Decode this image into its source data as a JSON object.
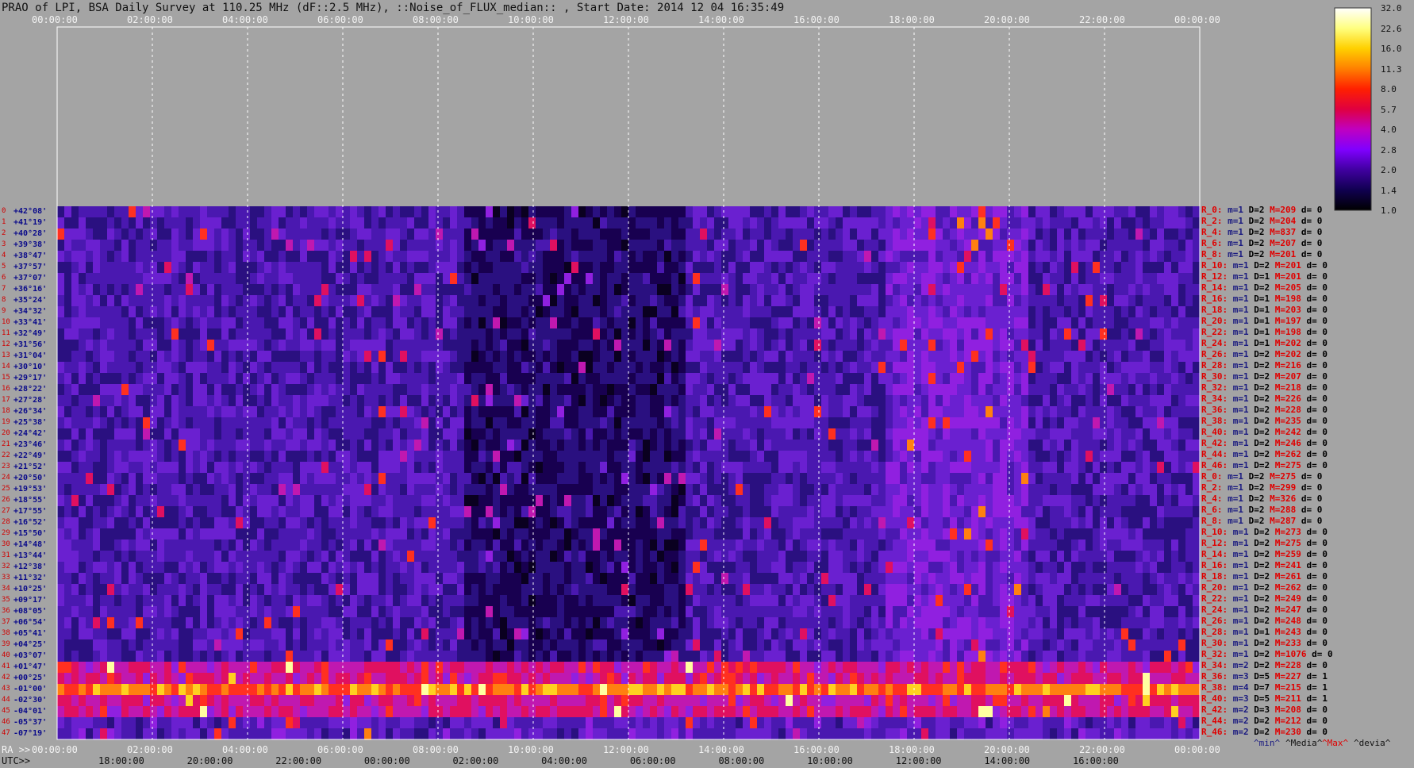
{
  "title": "PRAO of LPI, BSA Daily Survey at 110.25 MHz (dF::2.5 MHz), ::Noise_of_FLUX_median:: , Start Date: 2014 12 04 16:35:49",
  "chart_data": {
    "type": "heatmap",
    "x_top_ticks": [
      "00:00:00",
      "02:00:00",
      "04:00:00",
      "06:00:00",
      "08:00:00",
      "10:00:00",
      "12:00:00",
      "14:00:00",
      "16:00:00",
      "18:00:00",
      "20:00:00",
      "22:00:00",
      "00:00:00"
    ],
    "x_bottom_ra_label": "RA >>",
    "x_bottom_ticks": [
      "00:00:00",
      "02:00:00",
      "04:00:00",
      "06:00:00",
      "08:00:00",
      "10:00:00",
      "12:00:00",
      "14:00:00",
      "16:00:00",
      "18:00:00",
      "20:00:00",
      "22:00:00",
      "00:00:00"
    ],
    "x_utc_label": "UTC>>",
    "x_utc_ticks": [
      "18:00:00",
      "20:00:00",
      "22:00:00",
      "00:00:00",
      "02:00:00",
      "04:00:00",
      "06:00:00",
      "08:00:00",
      "10:00:00",
      "12:00:00",
      "14:00:00",
      "16:00:00"
    ],
    "dec_labels": [
      "+42°08'",
      "+41°19'",
      "+40°28'",
      "+39°38'",
      "+38°47'",
      "+37°57'",
      "+37°07'",
      "+36°16'",
      "+35°24'",
      "+34°32'",
      "+33°41'",
      "+32°49'",
      "+31°56'",
      "+31°04'",
      "+30°10'",
      "+29°17'",
      "+28°22'",
      "+27°28'",
      "+26°34'",
      "+25°38'",
      "+24°42'",
      "+23°46'",
      "+22°49'",
      "+21°52'",
      "+20°50'",
      "+19°53'",
      "+18°55'",
      "+17°55'",
      "+16°52'",
      "+15°50'",
      "+14°48'",
      "+13°44'",
      "+12°38'",
      "+11°32'",
      "+10°25'",
      "+09°17'",
      "+08°05'",
      "+06°54'",
      "+05°41'",
      "+04°25'",
      "+03°07'",
      "+01°47'",
      "+00°25'",
      "-01°00'",
      "-02°30'",
      "-04°01'",
      "-05°37'",
      "-07°19'"
    ],
    "colorbar_ticks": [
      "32.0",
      "22.6",
      "16.0",
      "11.3",
      "8.0",
      "5.7",
      "4.0",
      "2.8",
      "2.0",
      "1.4",
      "1.0"
    ],
    "colorbar_colors": [
      "#ffffff",
      "#ffff80",
      "#ffd000",
      "#ff8000",
      "#ff2000",
      "#e00040",
      "#c000c0",
      "#8000ff",
      "#4000a0",
      "#100050",
      "#000000"
    ],
    "stats_rows": [
      {
        "r": "R_0:",
        "m": "m=1",
        "D": "D=2",
        "M": "M=209",
        "d": "d= 0"
      },
      {
        "r": "R_2:",
        "m": "m=1",
        "D": "D=2",
        "M": "M=204",
        "d": "d= 0"
      },
      {
        "r": "R_4:",
        "m": "m=1",
        "D": "D=2",
        "M": "M=837",
        "d": "d= 0"
      },
      {
        "r": "R_6:",
        "m": "m=1",
        "D": "D=2",
        "M": "M=207",
        "d": "d= 0"
      },
      {
        "r": "R_8:",
        "m": "m=1",
        "D": "D=2",
        "M": "M=201",
        "d": "d= 0"
      },
      {
        "r": "R_10:",
        "m": "m=1",
        "D": "D=2",
        "M": "M=201",
        "d": "d= 0"
      },
      {
        "r": "R_12:",
        "m": "m=1",
        "D": "D=1",
        "M": "M=201",
        "d": "d= 0"
      },
      {
        "r": "R_14:",
        "m": "m=1",
        "D": "D=2",
        "M": "M=205",
        "d": "d= 0"
      },
      {
        "r": "R_16:",
        "m": "m=1",
        "D": "D=1",
        "M": "M=198",
        "d": "d= 0"
      },
      {
        "r": "R_18:",
        "m": "m=1",
        "D": "D=1",
        "M": "M=203",
        "d": "d= 0"
      },
      {
        "r": "R_20:",
        "m": "m=1",
        "D": "D=1",
        "M": "M=197",
        "d": "d= 0"
      },
      {
        "r": "R_22:",
        "m": "m=1",
        "D": "D=1",
        "M": "M=198",
        "d": "d= 0"
      },
      {
        "r": "R_24:",
        "m": "m=1",
        "D": "D=1",
        "M": "M=202",
        "d": "d= 0"
      },
      {
        "r": "R_26:",
        "m": "m=1",
        "D": "D=2",
        "M": "M=202",
        "d": "d= 0"
      },
      {
        "r": "R_28:",
        "m": "m=1",
        "D": "D=2",
        "M": "M=216",
        "d": "d= 0"
      },
      {
        "r": "R_30:",
        "m": "m=1",
        "D": "D=2",
        "M": "M=207",
        "d": "d= 0"
      },
      {
        "r": "R_32:",
        "m": "m=1",
        "D": "D=2",
        "M": "M=218",
        "d": "d= 0"
      },
      {
        "r": "R_34:",
        "m": "m=1",
        "D": "D=2",
        "M": "M=226",
        "d": "d= 0"
      },
      {
        "r": "R_36:",
        "m": "m=1",
        "D": "D=2",
        "M": "M=228",
        "d": "d= 0"
      },
      {
        "r": "R_38:",
        "m": "m=1",
        "D": "D=2",
        "M": "M=235",
        "d": "d= 0"
      },
      {
        "r": "R_40:",
        "m": "m=1",
        "D": "D=2",
        "M": "M=242",
        "d": "d= 0"
      },
      {
        "r": "R_42:",
        "m": "m=1",
        "D": "D=2",
        "M": "M=246",
        "d": "d= 0"
      },
      {
        "r": "R_44:",
        "m": "m=1",
        "D": "D=2",
        "M": "M=262",
        "d": "d= 0"
      },
      {
        "r": "R_46:",
        "m": "m=1",
        "D": "D=2",
        "M": "M=275",
        "d": "d= 0"
      },
      {
        "r": "R_0:",
        "m": "m=1",
        "D": "D=2",
        "M": "M=275",
        "d": "d= 0"
      },
      {
        "r": "R_2:",
        "m": "m=1",
        "D": "D=2",
        "M": "M=299",
        "d": "d= 0"
      },
      {
        "r": "R_4:",
        "m": "m=1",
        "D": "D=2",
        "M": "M=326",
        "d": "d= 0"
      },
      {
        "r": "R_6:",
        "m": "m=1",
        "D": "D=2",
        "M": "M=288",
        "d": "d= 0"
      },
      {
        "r": "R_8:",
        "m": "m=1",
        "D": "D=2",
        "M": "M=287",
        "d": "d= 0"
      },
      {
        "r": "R_10:",
        "m": "m=1",
        "D": "D=2",
        "M": "M=273",
        "d": "d= 0"
      },
      {
        "r": "R_12:",
        "m": "m=1",
        "D": "D=2",
        "M": "M=275",
        "d": "d= 0"
      },
      {
        "r": "R_14:",
        "m": "m=1",
        "D": "D=2",
        "M": "M=259",
        "d": "d= 0"
      },
      {
        "r": "R_16:",
        "m": "m=1",
        "D": "D=2",
        "M": "M=241",
        "d": "d= 0"
      },
      {
        "r": "R_18:",
        "m": "m=1",
        "D": "D=2",
        "M": "M=261",
        "d": "d= 0"
      },
      {
        "r": "R_20:",
        "m": "m=1",
        "D": "D=2",
        "M": "M=262",
        "d": "d= 0"
      },
      {
        "r": "R_22:",
        "m": "m=1",
        "D": "D=2",
        "M": "M=249",
        "d": "d= 0"
      },
      {
        "r": "R_24:",
        "m": "m=1",
        "D": "D=2",
        "M": "M=247",
        "d": "d= 0"
      },
      {
        "r": "R_26:",
        "m": "m=1",
        "D": "D=2",
        "M": "M=248",
        "d": "d= 0"
      },
      {
        "r": "R_28:",
        "m": "m=1",
        "D": "D=1",
        "M": "M=243",
        "d": "d= 0"
      },
      {
        "r": "R_30:",
        "m": "m=1",
        "D": "D=2",
        "M": "M=233",
        "d": "d= 0"
      },
      {
        "r": "R_32:",
        "m": "m=1",
        "D": "D=2",
        "M": "M=1076",
        "d": "d= 0"
      },
      {
        "r": "R_34:",
        "m": "m=2",
        "D": "D=2",
        "M": "M=228",
        "d": "d= 0"
      },
      {
        "r": "R_36:",
        "m": "m=3",
        "D": "D=5",
        "M": "M=227",
        "d": "d= 1"
      },
      {
        "r": "R_38:",
        "m": "m=4",
        "D": "D=7",
        "M": "M=215",
        "d": "d= 1"
      },
      {
        "r": "R_40:",
        "m": "m=3",
        "D": "D=5",
        "M": "M=211",
        "d": "d= 1"
      },
      {
        "r": "R_42:",
        "m": "m=2",
        "D": "D=3",
        "M": "M=208",
        "d": "d= 0"
      },
      {
        "r": "R_44:",
        "m": "m=2",
        "D": "D=2",
        "M": "M=212",
        "d": "d= 0"
      },
      {
        "r": "R_46:",
        "m": "m=2",
        "D": "D=2",
        "M": "M=230",
        "d": "d= 0"
      }
    ],
    "legend": {
      "min": "^min^",
      "media": "^Media^",
      "max": "^Max^",
      "devia": "^devia^"
    }
  }
}
